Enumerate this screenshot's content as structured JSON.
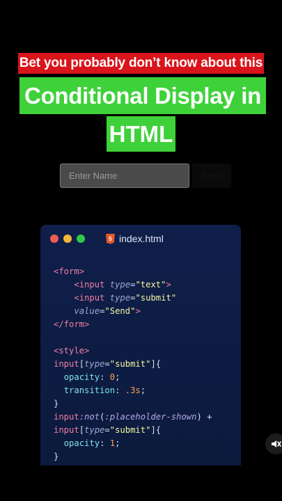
{
  "banner": {
    "subtitle": "Bet you probably don’t know about this"
  },
  "title": {
    "line1": "Conditional Display in",
    "line2": "HTML"
  },
  "demo": {
    "input_placeholder": "Enter Name",
    "button_label": "Send"
  },
  "editor": {
    "file_name": "index.html",
    "file_icon": "html5-icon",
    "window_dots": [
      "#ec5b55",
      "#f2b53c",
      "#2fc84a"
    ]
  },
  "code_lines": [
    "<form>",
    "    <input type=\"text\">",
    "    <input type=\"submit\"",
    "    value=\"Send\">",
    "</form>",
    "",
    "<style>",
    "input[type=\"submit\"]{",
    "  opacity: 0;",
    "  transition: .3s;",
    "}",
    "input:not(:placeholder-shown) +",
    "input[type=\"submit\"]{",
    "  opacity: 1;",
    "}"
  ],
  "controls": {
    "mute_icon": "speaker-muted-icon"
  }
}
